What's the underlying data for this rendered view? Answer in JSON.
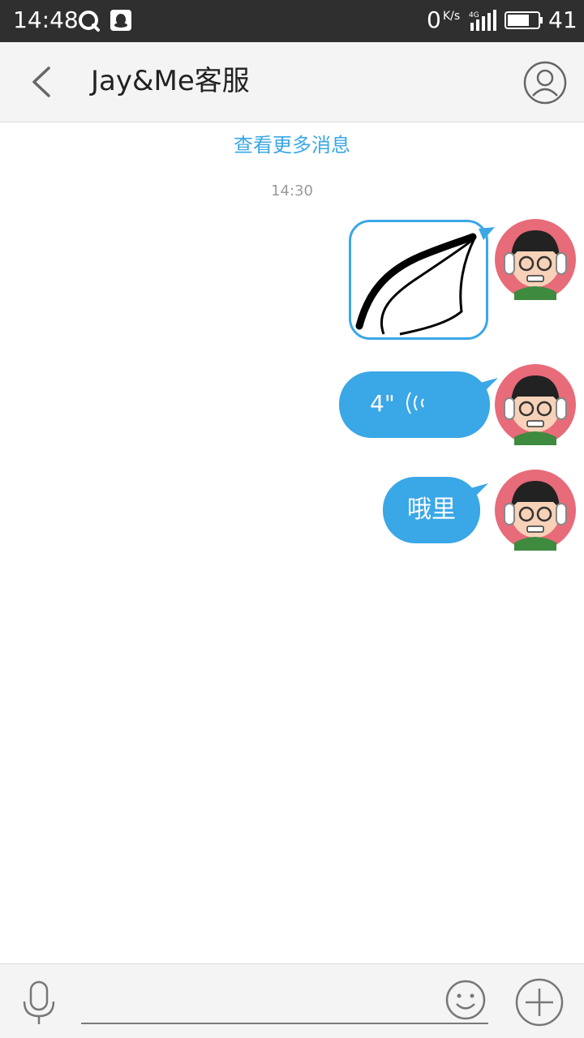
{
  "status_bar": {
    "time": "14:48",
    "net_speed": "0",
    "net_unit": "K/s",
    "network_type": "4G",
    "battery_level": "41",
    "icons": [
      "qq-icon",
      "app-notification-icon",
      "signal-icon",
      "battery-icon"
    ]
  },
  "header": {
    "title": "Jay&Me客服",
    "back_icon": "chevron-left-icon",
    "profile_icon": "user-profile-icon"
  },
  "chat": {
    "load_more": "查看更多消息",
    "timestamp": "14:30",
    "messages": [
      {
        "type": "image",
        "sender": "me",
        "content": "hand-drawn sketch"
      },
      {
        "type": "voice",
        "sender": "me",
        "duration": "4\""
      },
      {
        "type": "text",
        "sender": "me",
        "text": "哦里"
      }
    ]
  },
  "input_bar": {
    "value": "",
    "placeholder": "",
    "icons": [
      "microphone-icon",
      "emoji-icon",
      "plus-icon"
    ]
  },
  "colors": {
    "accent": "#3aa7e6",
    "status_bar": "#2f2f2f",
    "header_bg": "#f4f4f4",
    "avatar_ring": "#e86b7a"
  }
}
